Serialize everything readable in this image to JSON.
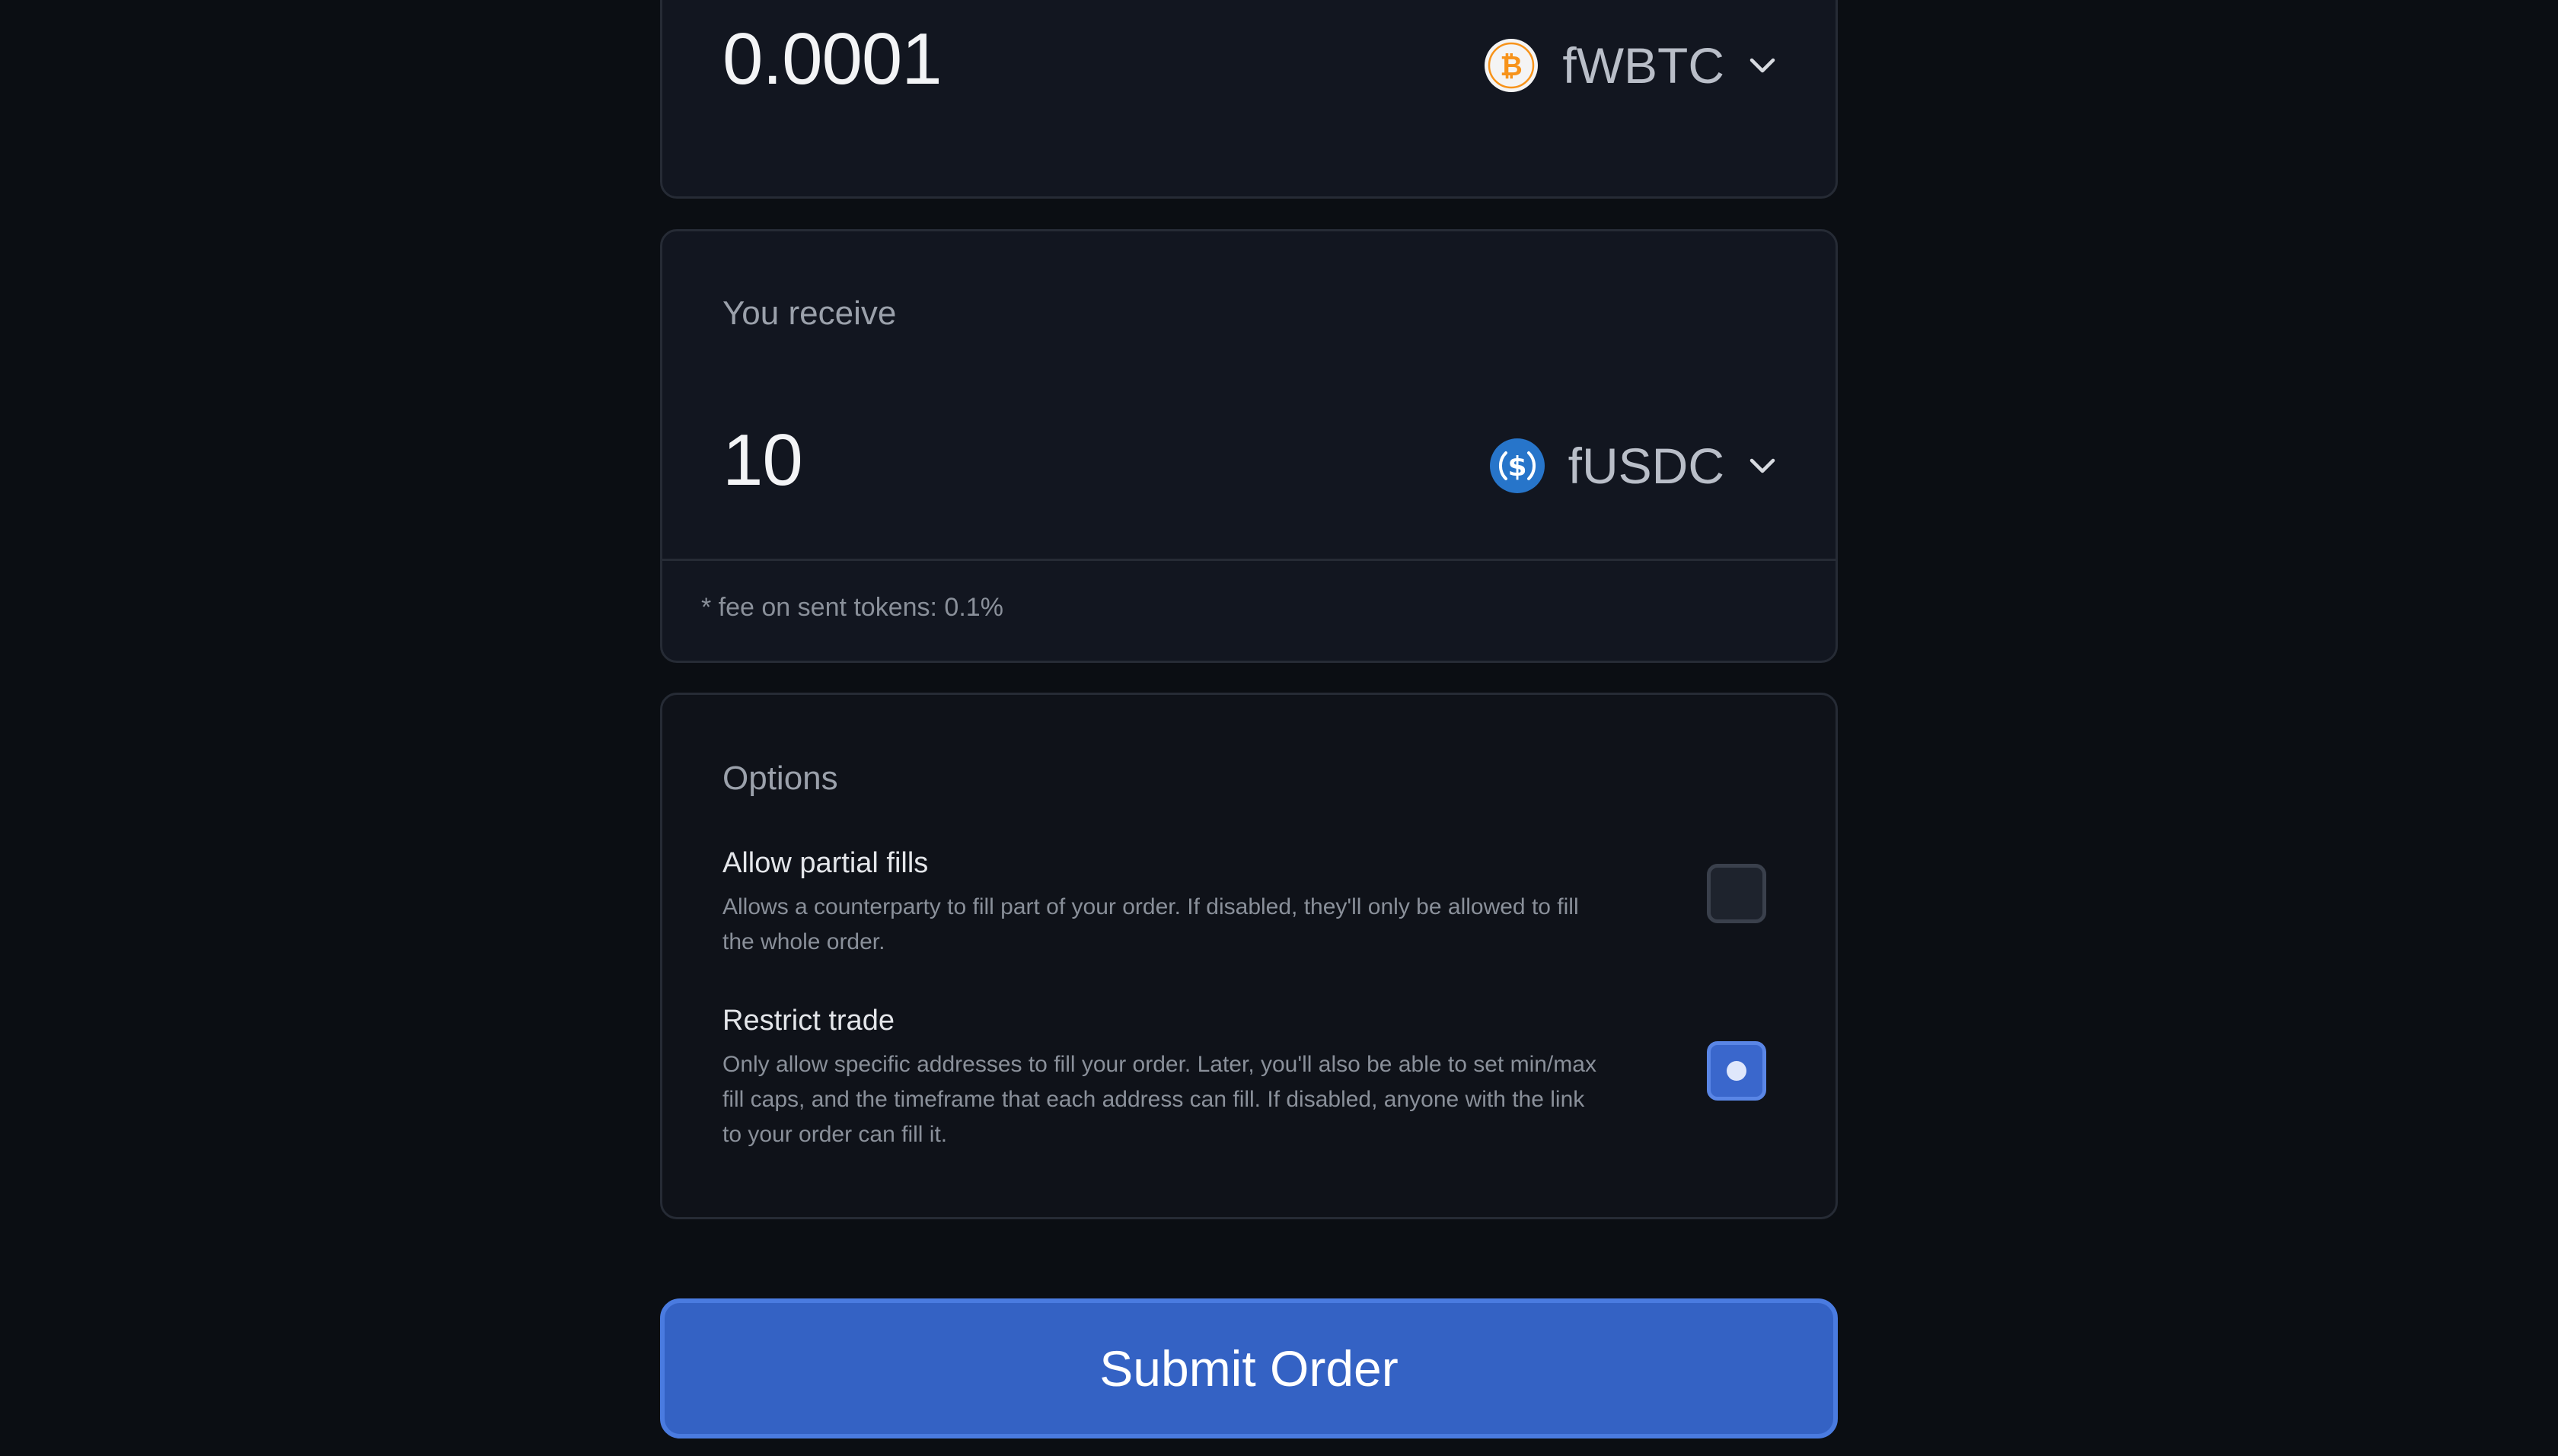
{
  "send": {
    "amount": "0.0001",
    "token": {
      "symbol": "fWBTC",
      "icon": "bitcoin-icon",
      "color": "#f7931a"
    }
  },
  "receive": {
    "label": "You receive",
    "amount": "10",
    "token": {
      "symbol": "fUSDC",
      "icon": "usdc-icon",
      "color": "#2775ca"
    },
    "fee_note": "* fee on sent tokens: 0.1%"
  },
  "options": {
    "title": "Options",
    "partial_fills": {
      "title": "Allow partial fills",
      "description": "Allows a counterparty to fill part of your order. If disabled, they'll only be allowed to fill the whole order.",
      "checked": false
    },
    "restrict_trade": {
      "title": "Restrict trade",
      "description": "Only allow specific addresses to fill your order. Later, you'll also be able to set min/max fill caps, and the timeframe that each address can fill. If disabled, anyone with the link to your order can fill it.",
      "checked": true
    }
  },
  "submit_label": "Submit Order",
  "colors": {
    "background": "#0b0e13",
    "card": "#121620",
    "accent": "#3462c4"
  }
}
